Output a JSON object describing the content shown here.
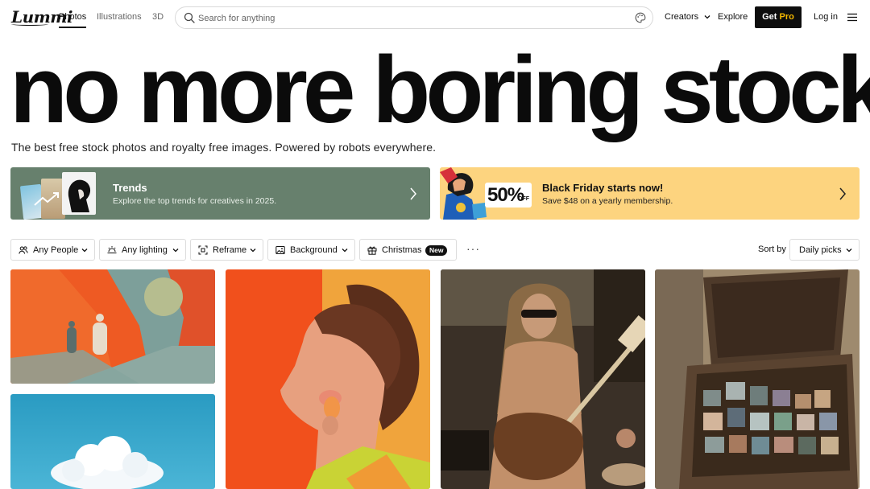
{
  "nav": {
    "logo": "Lummi",
    "media_tabs": [
      {
        "label": "Photos",
        "active": true
      },
      {
        "label": "Illustrations",
        "active": false
      },
      {
        "label": "3D",
        "active": false
      }
    ],
    "search": {
      "placeholder": "Search for anything",
      "value": ""
    },
    "creators_label": "Creators",
    "explore_label": "Explore",
    "get_pro": {
      "prefix": "Get ",
      "suffix": "Pro"
    },
    "login_label": "Log in"
  },
  "hero": {
    "title": "no more boring stock",
    "subtitle": "The best free stock photos and royalty free images. Powered by robots everywhere."
  },
  "banners": {
    "trends": {
      "title": "Trends",
      "description": "Explore the top trends for creatives in 2025.",
      "bg_color": "#67806d"
    },
    "black_friday": {
      "title": "Black Friday starts now!",
      "description": "Save $48 on a yearly membership.",
      "sale_value": "50%",
      "sale_suffix": "OFF",
      "bg_color": "#fdd47f"
    }
  },
  "filters": [
    {
      "label": "Any People",
      "icon": "people-icon"
    },
    {
      "label": "Any lighting",
      "icon": "lighting-icon"
    },
    {
      "label": "Reframe",
      "icon": "reframe-icon"
    },
    {
      "label": "Background",
      "icon": "image-icon"
    },
    {
      "label": "Christmas",
      "icon": "gift-icon",
      "badge": "New"
    }
  ],
  "sort": {
    "label": "Sort by",
    "value": "Daily picks"
  },
  "accent_colors": {
    "pro": "#f5b800",
    "button_dark": "#0d0d0d"
  }
}
